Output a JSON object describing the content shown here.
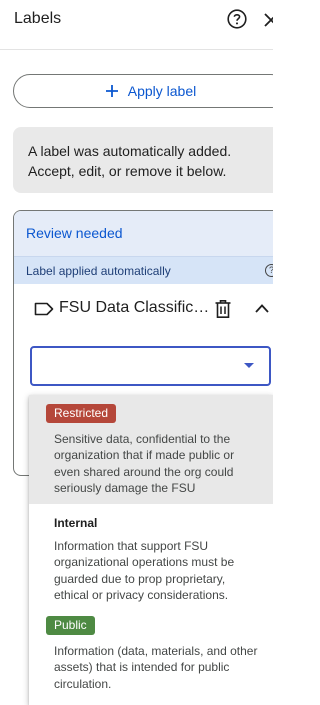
{
  "header": {
    "title": "Labels",
    "help_icon": "help-circle-icon",
    "close_icon": "close-icon"
  },
  "apply_button": {
    "icon": "plus-icon",
    "label": "Apply label"
  },
  "info": {
    "text": "A label was automatically added. Accept, edit, or remove it below."
  },
  "review_card": {
    "title": "Review needed",
    "subtitle": "Label applied automatically",
    "subtitle_icon": "help-icon",
    "label": {
      "name": "FSU Data Classific…",
      "tag_icon": "label-tag-icon",
      "delete_icon": "trash-icon",
      "collapse_icon": "chevron-up-icon"
    }
  },
  "select": {
    "value": "",
    "caret_icon": "caret-down-icon"
  },
  "options": [
    {
      "label": "Restricted",
      "style": "chip",
      "color": "#b5473a",
      "selected": true,
      "description": "Sensitive data, confidential to the organization that if made public or even shared around the org could seriously damage the FSU"
    },
    {
      "label": "Internal",
      "style": "plain",
      "color": "",
      "selected": false,
      "description": "Information that support FSU organizational operations must be guarded due to prop proprietary, ethical or privacy considerations."
    },
    {
      "label": "Public",
      "style": "chip",
      "color": "#4e8a43",
      "selected": false,
      "description": "Information (data, materials, and other assets) that is intended for public circulation."
    }
  ],
  "colors": {
    "accent": "#0b57d0",
    "select_border": "#3d57c4",
    "card_header_bg": "#e5ecf8",
    "card_sub_bg": "#d6e4f7",
    "info_bg": "#e9e9e9"
  }
}
